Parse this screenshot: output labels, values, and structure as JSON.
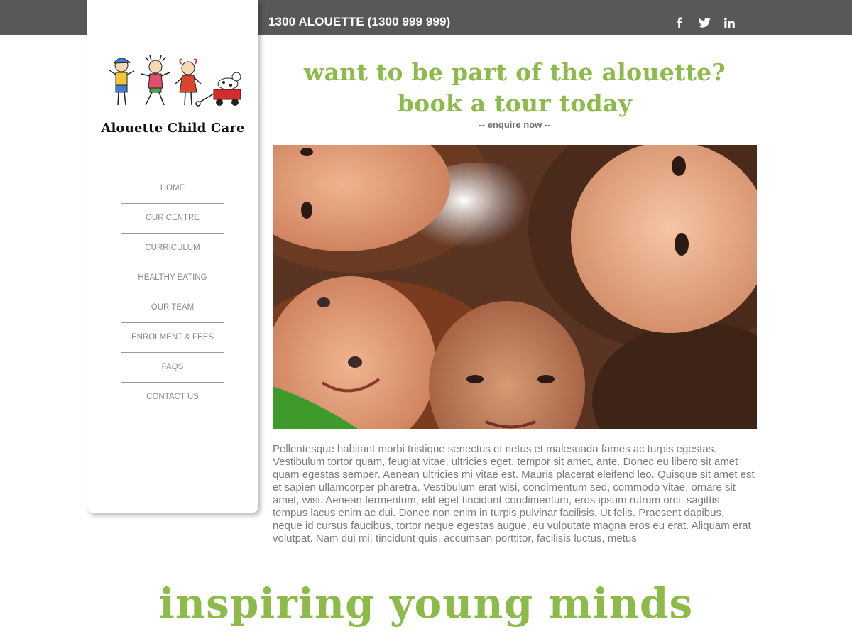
{
  "header": {
    "phone": "1300 ALOUETTE (1300 999 999)",
    "social": [
      {
        "icon": "facebook-icon"
      },
      {
        "icon": "twitter-icon"
      },
      {
        "icon": "linkedin-icon"
      }
    ]
  },
  "sidebar": {
    "brand": "Alouette Child Care",
    "nav": [
      "HOME",
      "OUR CENTRE",
      "CURRICULUM",
      "HEALTHY EATING",
      "OUR TEAM",
      "ENROLMENT & FEES",
      "FAQS",
      "CONTACT US"
    ]
  },
  "main": {
    "headline_line1": "want to be part of the alouette?",
    "headline_line2": "book a tour today",
    "enquire": "-- enquire now --",
    "body": "Pellentesque habitant morbi tristique senectus et netus et malesuada fames ac turpis egestas. Vestibulum tortor quam, feugiat vitae, ultricies eget, tempor sit amet, ante. Donec eu libero sit amet quam egestas semper. Aenean ultricies mi vitae est. Mauris placerat eleifend leo. Quisque sit amet est et sapien ullamcorper pharetra. Vestibulum erat wisi, condimentum sed, commodo vitae, ornare sit amet, wisi. Aenean fermentum, elit eget tincidunt condimentum, eros ipsum rutrum orci, sagittis tempus lacus enim ac dui. Donec non enim in turpis pulvinar facilisis. Ut felis. Praesent dapibus, neque id cursus faucibus, tortor neque egestas augue, eu vulputate magna eros eu erat. Aliquam erat volutpat. Nam dui mi, tincidunt quis, accumsan porttitor, facilisis luctus, metus"
  },
  "footer": {
    "tagline": "inspiring young minds"
  },
  "colors": {
    "topbar": "#585858",
    "accent_green": "#8dbb4a",
    "nav_text": "#8a8a8a",
    "body_text": "#7b7b7b"
  }
}
